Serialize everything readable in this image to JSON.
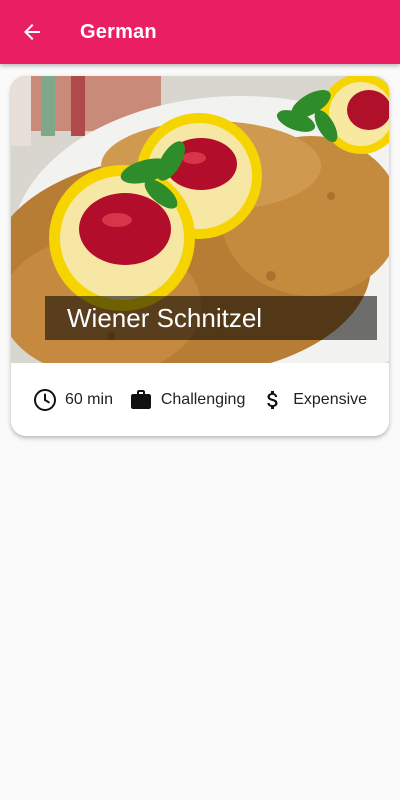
{
  "appbar": {
    "title": "German",
    "back_icon": "arrow-back-icon",
    "color": "#e91e63"
  },
  "meal": {
    "title": "Wiener Schnitzel",
    "image": "photo of breaded schnitzel with lemon slices, cranberry jam and parsley"
  },
  "details": {
    "duration": {
      "icon": "clock-icon",
      "label": "60 min"
    },
    "complexity": {
      "icon": "briefcase-icon",
      "label": "Challenging"
    },
    "affordability": {
      "icon": "dollar-icon",
      "label": "Expensive"
    }
  }
}
